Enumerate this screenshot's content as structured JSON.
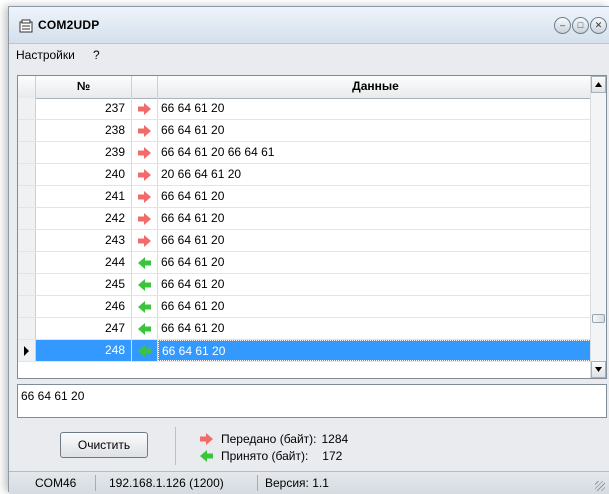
{
  "window": {
    "title": "COM2UDP"
  },
  "menu": {
    "items": [
      "Настройки",
      "?"
    ]
  },
  "grid": {
    "headers": {
      "num": "№",
      "data": "Данные"
    },
    "rows": [
      {
        "num": "237",
        "dir": "out",
        "data": "66 64 61 20"
      },
      {
        "num": "238",
        "dir": "out",
        "data": "66 64 61 20"
      },
      {
        "num": "239",
        "dir": "out",
        "data": "66 64 61 20 66 64 61"
      },
      {
        "num": "240",
        "dir": "out",
        "data": "20 66 64 61 20"
      },
      {
        "num": "241",
        "dir": "out",
        "data": "66 64 61 20"
      },
      {
        "num": "242",
        "dir": "out",
        "data": "66 64 61 20"
      },
      {
        "num": "243",
        "dir": "out",
        "data": "66 64 61 20"
      },
      {
        "num": "244",
        "dir": "in",
        "data": "66 64 61 20"
      },
      {
        "num": "245",
        "dir": "in",
        "data": "66 64 61 20"
      },
      {
        "num": "246",
        "dir": "in",
        "data": "66 64 61 20"
      },
      {
        "num": "247",
        "dir": "in",
        "data": "66 64 61 20"
      },
      {
        "num": "248",
        "dir": "in",
        "data": "66 64 61 20"
      }
    ],
    "selected_num": "248"
  },
  "detail_text": "66 64 61 20",
  "controls": {
    "clear_label": "Очистить",
    "sent_label": "Передано (байт):",
    "sent_value": "1284",
    "received_label": "Принято (байт):",
    "received_value": "172"
  },
  "statusbar": {
    "port": "COM46",
    "address": "192.168.1.126 (1200)",
    "version": "Версия: 1.1"
  },
  "colors": {
    "out_arrow": "#f26b6b",
    "in_arrow": "#3cc43c",
    "selection": "#3399ff"
  },
  "icons": {
    "out": "arrow-right-icon",
    "in": "arrow-left-icon",
    "app": "app-icon"
  }
}
